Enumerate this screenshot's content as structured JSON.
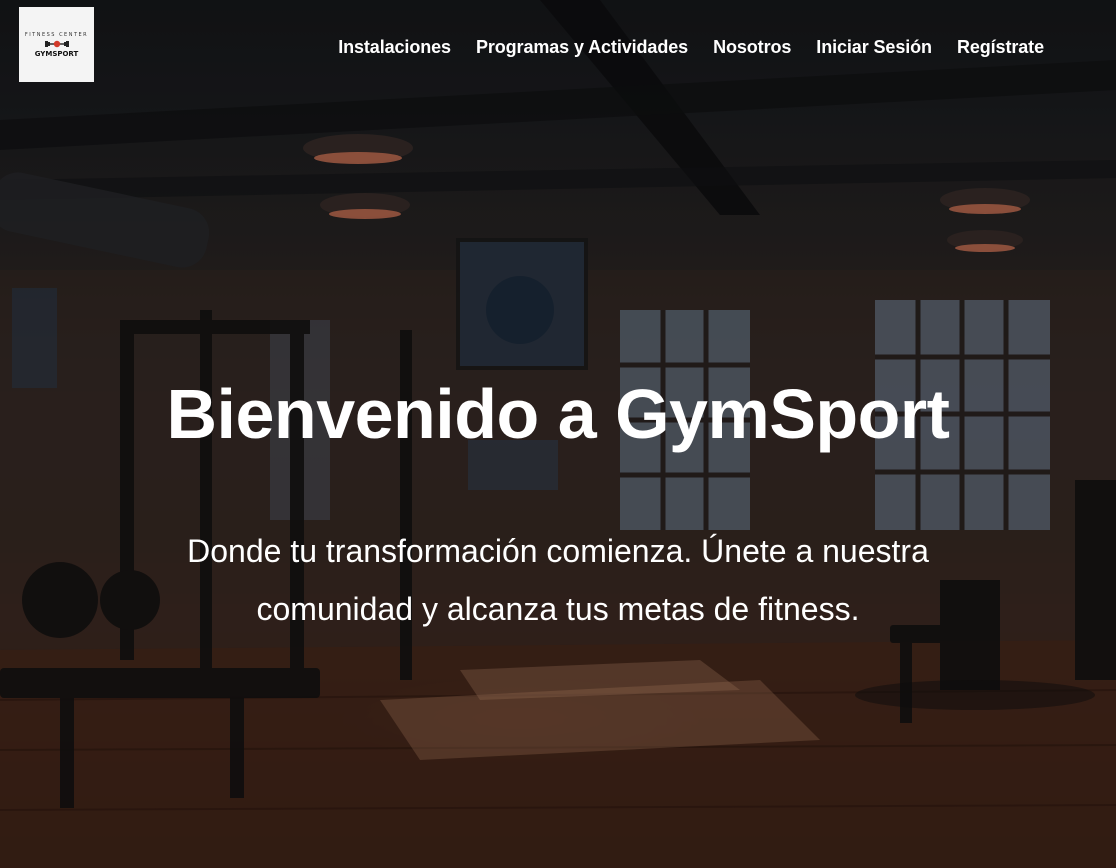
{
  "logo": {
    "tagline": "FITNESS CENTER",
    "brand": "GYMSPORT"
  },
  "nav": {
    "items": [
      {
        "label": "Instalaciones"
      },
      {
        "label": "Programas y Actividades"
      },
      {
        "label": "Nosotros"
      },
      {
        "label": "Iniciar Sesión"
      },
      {
        "label": "Regístrate"
      }
    ]
  },
  "hero": {
    "title": "Bienvenido a GymSport",
    "subtitle": "Donde tu transformación comienza. Únete a nuestra comunidad y alcanza tus metas de fitness."
  },
  "colors": {
    "text": "#ffffff",
    "logo_bg": "#f4f4f4",
    "accent_red": "#d23a2a"
  }
}
